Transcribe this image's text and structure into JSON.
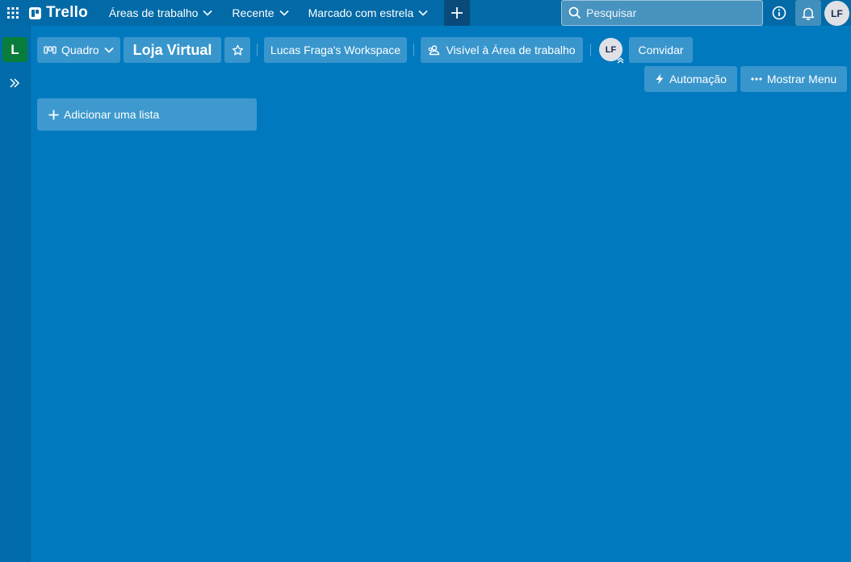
{
  "topnav": {
    "apps_icon": "grid-icon",
    "logo_text": "Trello",
    "menus": [
      {
        "label": "Áreas de trabalho",
        "icon": "chevron-down-icon"
      },
      {
        "label": "Recente",
        "icon": "chevron-down-icon"
      },
      {
        "label": "Marcado com estrela",
        "icon": "chevron-down-icon"
      }
    ],
    "create_icon": "plus-icon",
    "search": {
      "placeholder": "Pesquisar",
      "value": ""
    },
    "info_icon": "info-icon",
    "notifications_icon": "bell-icon",
    "user_initials": "LF"
  },
  "sidebar": {
    "workspace_letter": "L",
    "workspace_color": "#087c3a",
    "expand_icon": "double-chevron-right-icon"
  },
  "board": {
    "view_label": "Quadro",
    "title": "Loja Virtual",
    "workspace_label": "Lucas Fraga's Workspace",
    "visibility_label": "Visível à Área de trabalho",
    "member_initials": "LF",
    "invite_label": "Convidar",
    "automation_label": "Automação",
    "menu_label": "Mostrar Menu",
    "add_list_label": "Adicionar uma lista",
    "background_color": "#0079bf"
  }
}
